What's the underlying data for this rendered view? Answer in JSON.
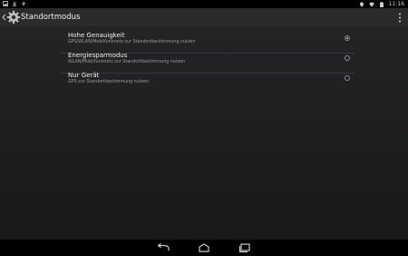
{
  "status_bar": {
    "time": "11:16",
    "left_icons": [
      "image-icon",
      "download-icon",
      "usb-debug-icon"
    ],
    "right_icons": [
      "location-icon",
      "wifi-icon",
      "battery-icon"
    ]
  },
  "action_bar": {
    "title": "Standortmodus",
    "icons": [
      "back-icon",
      "settings-gear-icon",
      "overflow-menu-icon"
    ]
  },
  "options": [
    {
      "title": "Hohe Genauigkeit",
      "summary": "GPS/WLAN/Mobilfunknetz zur Standortbestimmung nutzen",
      "selected": true
    },
    {
      "title": "Energiesparmodus",
      "summary": "WLAN/Mobilfunknetz zur Standortbestimmung nutzen",
      "selected": false
    },
    {
      "title": "Nur Gerät",
      "summary": "GPS zur Standortbestimmung nutzen",
      "selected": false
    }
  ],
  "nav_bar": {
    "icons": [
      "back-nav-icon",
      "home-nav-icon",
      "recents-nav-icon"
    ]
  },
  "colors": {
    "background": "#1b1c1e",
    "action_bar": "#2a2b2d",
    "text_primary": "#f2f2f2",
    "text_secondary": "#9b9b9b"
  }
}
